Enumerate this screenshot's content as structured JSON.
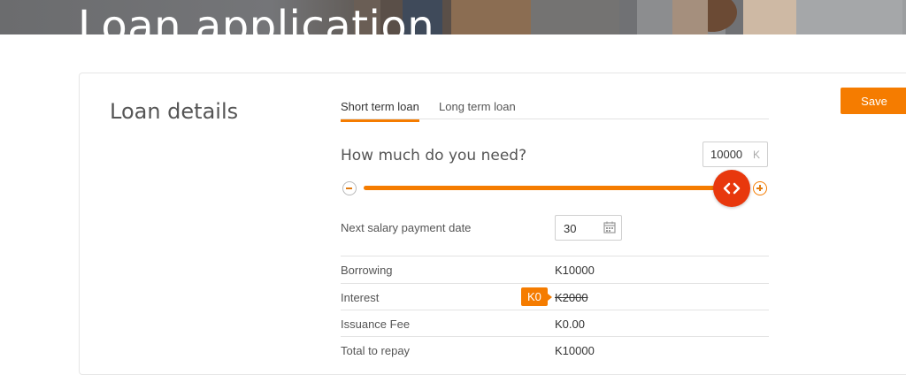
{
  "header": {
    "title": "Loan application"
  },
  "section": {
    "title": "Loan details"
  },
  "actions": {
    "save_label": "Save"
  },
  "tabs": [
    {
      "label": "Short term loan",
      "active": true
    },
    {
      "label": "Long term loan",
      "active": false
    }
  ],
  "amount": {
    "label": "How much do you need?",
    "value": "10000",
    "unit": "K",
    "slider_fraction": 1.0
  },
  "salary": {
    "label": "Next salary payment date",
    "value": "30"
  },
  "summary": [
    {
      "label": "Borrowing",
      "value": "K10000"
    },
    {
      "label": "Interest",
      "value": "K2000",
      "discounted_value": "K0"
    },
    {
      "label": "Issuance Fee",
      "value": "K0.00"
    },
    {
      "label": "Total to repay",
      "value": "K10000"
    }
  ],
  "colors": {
    "accent": "#f57c00",
    "thumb": "#e8380d"
  },
  "icons": [
    "minus-icon",
    "plus-icon",
    "arrows-left-right-icon",
    "calendar-icon"
  ]
}
